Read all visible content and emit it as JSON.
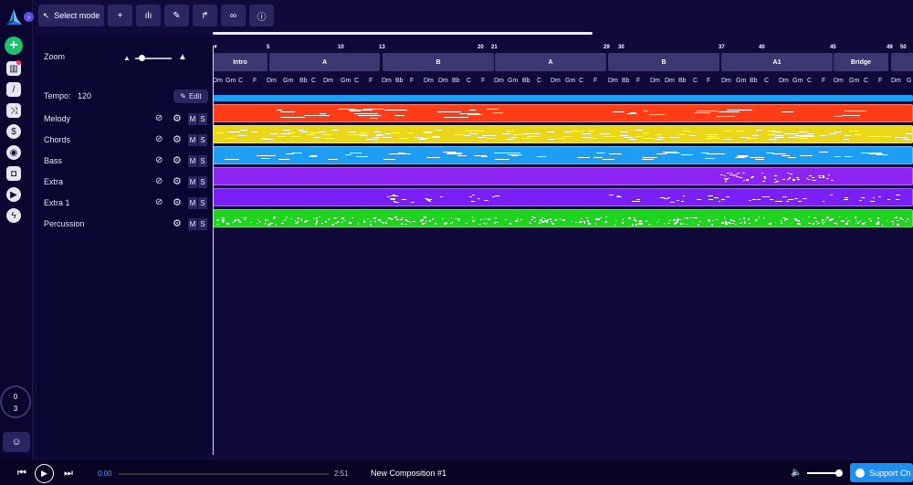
{
  "toolbar": {
    "select_mode_label": "Select mode",
    "icons": [
      "cursor-icon",
      "plus-icon",
      "equalizer-icon",
      "pencil-icon",
      "redo-icon",
      "link-icon",
      "info-icon"
    ]
  },
  "sidebar": {
    "counter_top": "0",
    "counter_bottom": "3"
  },
  "left_panel": {
    "zoom_label": "Zoom",
    "zoom_level": 0.1,
    "tempo_label": "Tempo:",
    "tempo_value": "120",
    "edit_label": "Edit"
  },
  "tracks": [
    {
      "name": "Melody",
      "color": "#ff3d16",
      "has_eye": true
    },
    {
      "name": "Chords",
      "color": "#ead71a",
      "has_eye": true
    },
    {
      "name": "Bass",
      "color": "#1e9ef2",
      "has_eye": true
    },
    {
      "name": "Extra",
      "color": "#8e24f2",
      "has_eye": true
    },
    {
      "name": "Extra 1",
      "color": "#7a1ff5",
      "has_eye": true
    },
    {
      "name": "Percussion",
      "color": "#1fd41f",
      "has_eye": false
    }
  ],
  "track_controls": {
    "mute": "M",
    "solo": "S"
  },
  "timeline": {
    "bar_numbers": [
      "5",
      "10",
      "13",
      "20",
      "21",
      "29",
      "30",
      "37",
      "40",
      "45",
      "49",
      "50"
    ],
    "sections": [
      "Intro",
      "A",
      "B",
      "A",
      "B",
      "A1",
      "Bridge",
      ""
    ],
    "chords": [
      "Dm",
      "Gm",
      "C",
      "F",
      "Dm",
      "Gm",
      "Bb",
      "C",
      "Dm",
      "Gm",
      "C",
      "F",
      "Dm",
      "Bb",
      "F",
      "Dm",
      "Dm",
      "Bb",
      "C",
      "F",
      "Dm",
      "Gm",
      "Bb",
      "C",
      "Dm",
      "Gm",
      "C",
      "F",
      "Dm",
      "Bb",
      "F",
      "Dm",
      "Dm",
      "Bb",
      "C",
      "F",
      "Dm",
      "Gm",
      "Bb",
      "C",
      "Dm",
      "Gm",
      "C",
      "F",
      "Dm",
      "Gm",
      "C",
      "F",
      "Dm",
      "G"
    ],
    "marker_color": "#1e9ef2"
  },
  "player": {
    "current_time": "0:00",
    "total_time": "2:51",
    "composition_name": "New Composition #1",
    "volume_level": 0.85,
    "support_label": "Support Ch"
  }
}
